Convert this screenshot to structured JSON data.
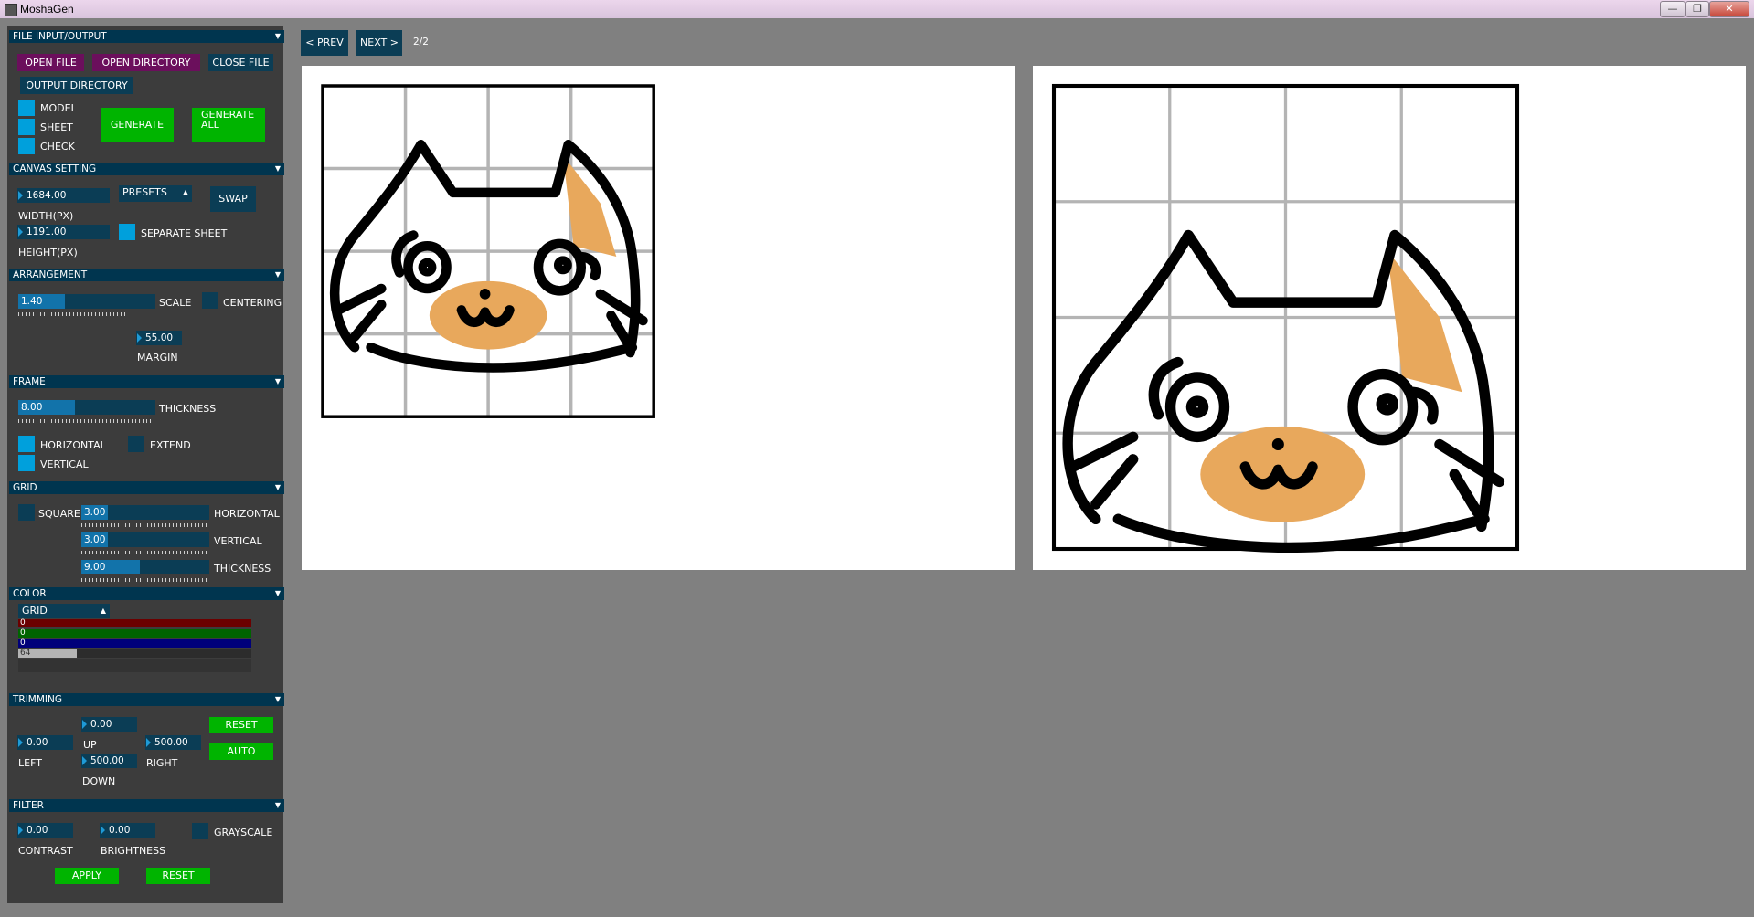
{
  "window": {
    "title": "MoshaGen",
    "controls": [
      "—",
      "❐",
      "✕"
    ]
  },
  "toolbar": {
    "prev_label": "< PREV",
    "next_label": "NEXT >",
    "page_indicator": "2/2"
  },
  "file_io": {
    "header": "FILE INPUT/OUTPUT",
    "open_file": "OPEN FILE",
    "open_directory": "OPEN DIRECTORY",
    "close_file": "CLOSE FILE",
    "output_directory": "OUTPUT DIRECTORY",
    "model_label": "MODEL",
    "sheet_label": "SHEET",
    "check_label": "CHECK",
    "model_checked": true,
    "sheet_checked": true,
    "check_checked": true,
    "generate": "GENERATE",
    "generate_all": "GENERATE ALL"
  },
  "canvas_setting": {
    "header": "CANVAS SETTING",
    "width_value": "1684.00",
    "width_label": "WIDTH(PX)",
    "height_value": "1191.00",
    "height_label": "HEIGHT(PX)",
    "presets_label": "PRESETS",
    "swap_label": "SWAP",
    "separate_sheet_label": "SEPARATE SHEET",
    "separate_sheet_checked": true
  },
  "arrangement": {
    "header": "ARRANGEMENT",
    "scale_value": "1.40",
    "scale_fill": 0.34,
    "scale_label": "SCALE",
    "centering_label": "CENTERING",
    "centering_checked": false,
    "margin_value": "55.00",
    "margin_label": "MARGIN"
  },
  "frame": {
    "header": "FRAME",
    "thickness_value": "8.00",
    "thickness_fill": 0.41,
    "thickness_label": "THICKNESS",
    "horizontal_label": "HORIZONTAL",
    "horizontal_checked": true,
    "extend_label": "EXTEND",
    "extend_checked": false,
    "vertical_label": "VERTICAL",
    "vertical_checked": true
  },
  "grid": {
    "header": "GRID",
    "square_label": "SQUARE",
    "square_checked": false,
    "horizontal_value": "3.00",
    "horizontal_label": "HORIZONTAL",
    "horizontal_fill": 0.21,
    "vertical_value": "3.00",
    "vertical_label": "VERTICAL",
    "vertical_fill": 0.21,
    "thickness_value": "9.00",
    "thickness_label": "THICKNESS",
    "thickness_fill": 0.46
  },
  "color": {
    "header": "COLOR",
    "target": "GRID",
    "r": "0",
    "g": "0",
    "b": "0",
    "a": "64",
    "a_fill": 0.25,
    "colors": {
      "r": "#6b0000",
      "g": "#006400",
      "b": "#00007a",
      "a": "#b4b4b4"
    }
  },
  "trimming": {
    "header": "TRIMMING",
    "up_value": "0.00",
    "up_label": "UP",
    "left_value": "0.00",
    "left_label": "LEFT",
    "right_value": "500.00",
    "right_label": "RIGHT",
    "down_value": "500.00",
    "down_label": "DOWN",
    "reset": "RESET",
    "auto": "AUTO"
  },
  "filter": {
    "header": "FILTER",
    "contrast_value": "0.00",
    "contrast_label": "CONTRAST",
    "brightness_value": "0.00",
    "brightness_label": "BRIGHTNESS",
    "grayscale_label": "GRAYSCALE",
    "grayscale_checked": false,
    "apply": "APPLY",
    "reset": "RESET"
  },
  "theme": {
    "panel_bg": "#3c3c3c",
    "header_bg": "#00354f",
    "accent_blue": "#00a0dc",
    "button_magenta": "#6b0f5c",
    "button_green": "#00b400",
    "workspace_bg": "#808080",
    "cat_orange": "#e8a85c"
  }
}
